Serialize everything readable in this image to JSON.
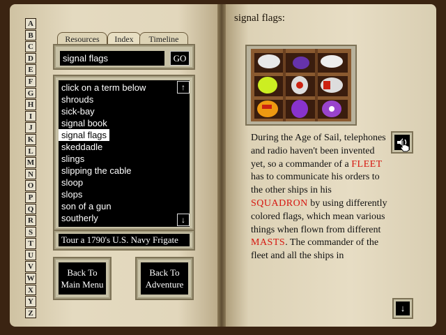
{
  "alphabet": [
    "A",
    "B",
    "C",
    "D",
    "E",
    "F",
    "G",
    "H",
    "I",
    "J",
    "K",
    "L",
    "M",
    "N",
    "O",
    "P",
    "Q",
    "R",
    "S",
    "T",
    "U",
    "V",
    "W",
    "X",
    "Y",
    "Z"
  ],
  "tabs": {
    "resources": "Resources",
    "index": "Index",
    "timeline": "Timeline"
  },
  "search": {
    "value": "signal flags",
    "go_label": "GO"
  },
  "index_list": {
    "items": [
      "click on a term below",
      "shrouds",
      "sick-bay",
      "signal book",
      "signal flags",
      "skeddadle",
      "slings",
      "slipping the cable",
      "sloop",
      "slops",
      "son of a gun",
      "southerly"
    ],
    "selected": "signal flags",
    "scroll_up": "↑",
    "scroll_down": "↓"
  },
  "tour_label": "Tour a 1790's U.S. Navy Frigate",
  "buttons": {
    "main_menu_line1": "Back To",
    "main_menu_line2": "Main Menu",
    "adventure_line1": "Back To",
    "adventure_line2": "Adventure"
  },
  "article": {
    "title": "signal flags:",
    "parts": [
      {
        "text": "During the Age of Sail, telephones and radio haven't been invented yet, so a commander of a ",
        "kw": false
      },
      {
        "text": "FLEET",
        "kw": true
      },
      {
        "text": " has to communicate his orders to the other ships in his ",
        "kw": false
      },
      {
        "text": "SQUADRON",
        "kw": true
      },
      {
        "text": " by using differently colored flags, which mean various things when flown from different ",
        "kw": false
      },
      {
        "text": "MASTS",
        "kw": true
      },
      {
        "text": ".  The commander of the fleet and all the ships in",
        "kw": false
      }
    ],
    "scroll_down": "↓"
  },
  "colors": {
    "keyword": "#d6150f",
    "panel": "#c7c1a6"
  },
  "icons": {
    "audio": "speaker-icon",
    "cursor": "hand-pointer-icon"
  }
}
